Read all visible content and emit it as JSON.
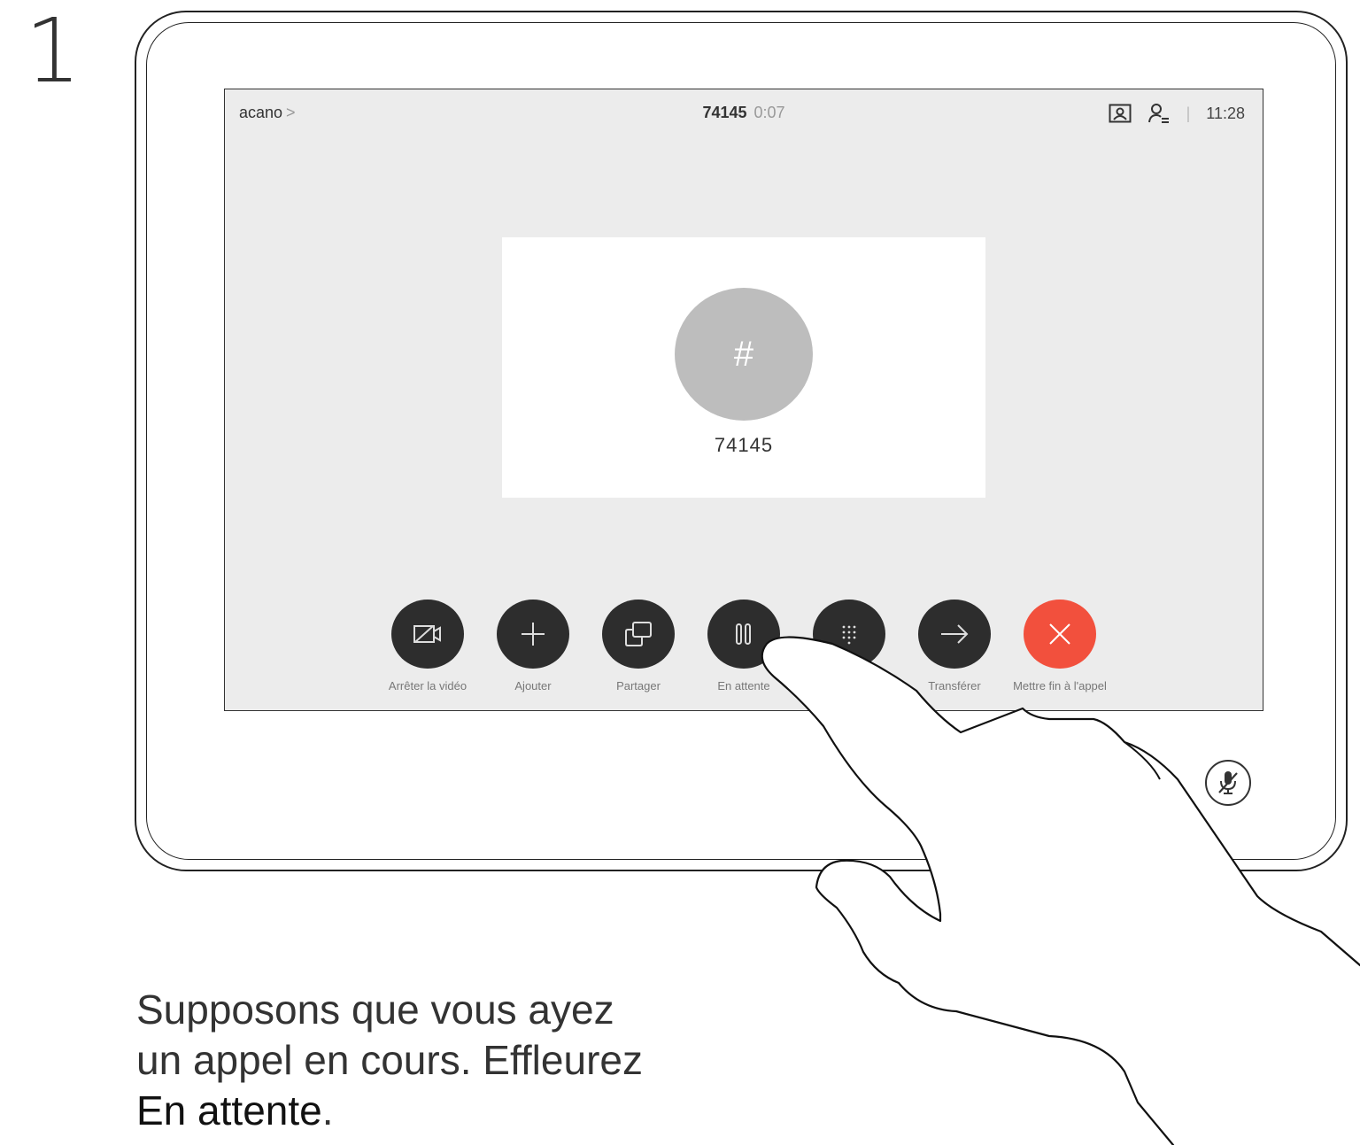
{
  "step": {
    "number": "1"
  },
  "status_bar": {
    "contact": "acano",
    "chevron": ">",
    "call_number": "74145",
    "call_duration": "0:07",
    "separator": "|",
    "time": "11:28"
  },
  "participant": {
    "avatar_symbol": "#",
    "number": "74145"
  },
  "controls": [
    {
      "label": "Arrêter la vidéo",
      "icon": "video-off-icon"
    },
    {
      "label": "Ajouter",
      "icon": "plus-icon"
    },
    {
      "label": "Partager",
      "icon": "share-icon"
    },
    {
      "label": "En attente",
      "icon": "pause-icon"
    },
    {
      "label": "",
      "icon": "keypad-icon"
    },
    {
      "label": "Transférer",
      "icon": "arrow-right-icon"
    },
    {
      "label": "Mettre fin à l'appel",
      "icon": "close-icon"
    }
  ],
  "caption": {
    "line1": "Supposons que vous ayez",
    "line2": "un appel en cours. Effleurez",
    "emphasis": "En attente",
    "end": "."
  },
  "colors": {
    "screen_bg": "#ececec",
    "button_dark": "#2d2d2d",
    "end_call_red": "#f2503d",
    "avatar_gray": "#bdbdbd"
  }
}
